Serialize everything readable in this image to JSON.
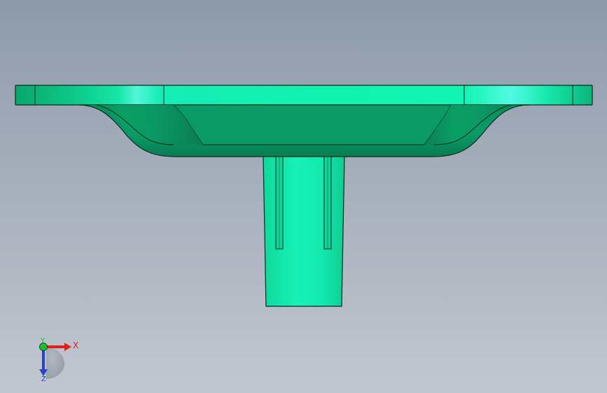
{
  "viewport": {
    "background_top": "#8e9aab",
    "background_bottom": "#c2c7cf"
  },
  "model": {
    "part_color_base": "#11b07a",
    "part_color_light": "#12f3b0",
    "part_color_shadow": "#0b8f5f",
    "edge_color": "#0b2a1f"
  },
  "triad": {
    "x_label": "X",
    "y_label": "Y",
    "z_label": "Z",
    "x_color": "#e01d1d",
    "y_color": "#18c02e",
    "z_color": "#2a43c8",
    "x_icon": "x-axis-arrow-icon",
    "y_icon": "y-axis-origin-icon",
    "z_icon": "z-axis-arrow-icon"
  }
}
